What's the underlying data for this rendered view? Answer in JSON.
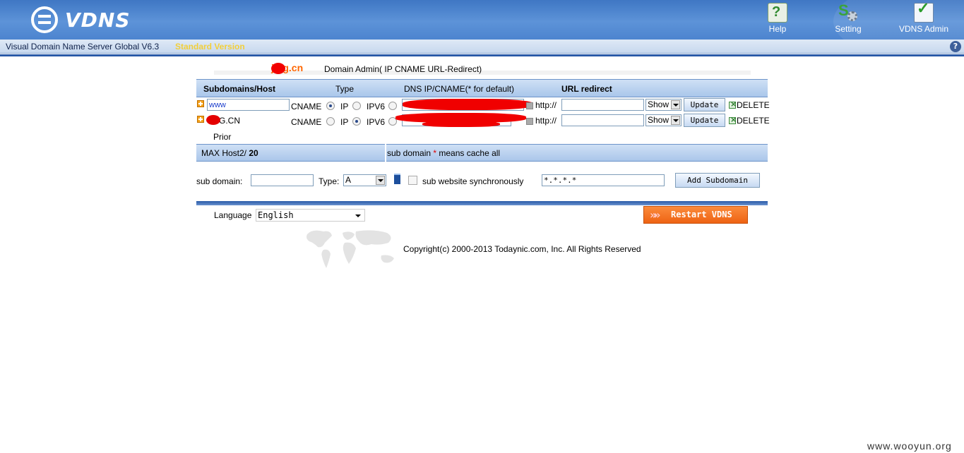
{
  "header": {
    "logo_text": "VDNS",
    "nav": {
      "help": "Help",
      "setting": "Setting",
      "admin": "VDNS Admin"
    }
  },
  "version_bar": {
    "title": "Visual Domain Name Server Global V6.3",
    "edition": "Standard Version",
    "help_glyph": "?"
  },
  "domain": {
    "name": "jmg.cn",
    "admin_label": "Domain Admin( IP CNAME URL-Redirect)"
  },
  "table": {
    "headers": {
      "host": "Subdomains/Host",
      "type": "Type",
      "dns": "DNS IP/CNAME(* for default)",
      "url": "URL redirect"
    },
    "type_labels": {
      "cname": "CNAME",
      "ip": "IP",
      "ipv6": "IPV6"
    },
    "http_label": "http://",
    "show_option": "Show",
    "update_label": "Update",
    "delete_label": "DELETE",
    "rows": [
      {
        "host": "www",
        "selected_type": "IP",
        "show": "Show"
      },
      {
        "host": "JMG.CN",
        "selected_type": "IPV6",
        "show": "Show"
      }
    ]
  },
  "prior_label": "Prior",
  "max_bar": {
    "label": "MAX Host2/ ",
    "value": "20",
    "note_prefix": "sub domain ",
    "note_star": "*",
    "note_suffix": " means cache all"
  },
  "add_form": {
    "sub_domain_label": "sub domain:",
    "type_label": "Type:",
    "type_value": "A",
    "sync_label": "sub website synchronously",
    "wildcard_value": "*.*.*.*",
    "add_button": "Add Subdomain"
  },
  "footer": {
    "language_label": "Language",
    "language_value": "English",
    "restart_button": "Restart VDNS",
    "copyright": "Copyright(c) 2000-2013 Todaynic.com, Inc. All Rights Reserved"
  },
  "watermark": "www.wooyun.org"
}
